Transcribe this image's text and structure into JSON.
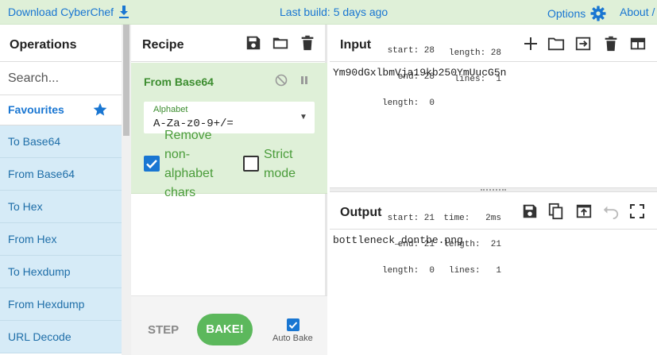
{
  "banner": {
    "download_label": "Download CyberChef",
    "last_build": "Last build: 5 days ago",
    "options_label": "Options",
    "about_label": "About /"
  },
  "operations": {
    "title": "Operations",
    "search_placeholder": "Search...",
    "favourites_label": "Favourites",
    "items": [
      {
        "label": "To Base64"
      },
      {
        "label": "From Base64"
      },
      {
        "label": "To Hex"
      },
      {
        "label": "From Hex"
      },
      {
        "label": "To Hexdump"
      },
      {
        "label": "From Hexdump"
      },
      {
        "label": "URL Decode"
      }
    ]
  },
  "recipe": {
    "title": "Recipe",
    "operation": {
      "name": "From Base64",
      "alphabet_label": "Alphabet",
      "alphabet_value": "A-Za-z0-9+/=",
      "remove_nonalpha_label": [
        "Remove",
        "non-",
        "alphabet",
        "chars"
      ],
      "remove_nonalpha_checked": true,
      "strict_mode_label": [
        "Strict",
        "mode"
      ],
      "strict_mode_checked": false
    },
    "step_label": "STEP",
    "bake_label": "BAKE!",
    "auto_bake_label": "Auto Bake",
    "auto_bake_checked": true
  },
  "input": {
    "title": "Input",
    "stats_left": [
      "start: 28",
      "end: 28",
      "length:  0"
    ],
    "stats_right": [
      "length: 28",
      "lines:  1"
    ],
    "text": "Ym90dGxlbmVja19kb250YmUucG5n"
  },
  "output": {
    "title": "Output",
    "stats_left": [
      "start: 21",
      "end: 21",
      "length:  0"
    ],
    "stats_right": [
      "time:   2ms",
      "length:  21",
      "lines:   1"
    ],
    "text": "bottleneck_dontbe.png"
  },
  "colors": {
    "banner_bg": "#dff0d8",
    "accent": "#1976d2",
    "favourite_item_bg": "#d6ebf7",
    "recipe_op_bg": "#dff0d8",
    "bake_button": "#5cb85c"
  }
}
